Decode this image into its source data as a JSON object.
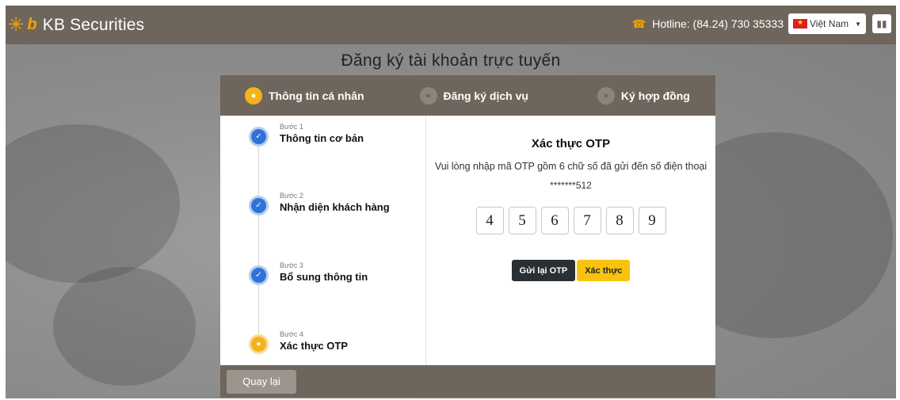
{
  "header": {
    "logo_text": "KB Securities",
    "hotline": "Hotline: (84.24) 730 35333",
    "language": "Việt Nam"
  },
  "page_title": "Đăng ký tài khoản trực tuyến",
  "tabs": [
    {
      "label": "Thông tin cá nhân",
      "active": true
    },
    {
      "label": "Đăng ký dịch vụ",
      "active": false
    },
    {
      "label": "Ký hợp đồng",
      "active": false
    }
  ],
  "steps": [
    {
      "small": "Bước 1",
      "name": "Thông tin cơ bản",
      "status": "done"
    },
    {
      "small": "Bước 2",
      "name": "Nhận diện khách hàng",
      "status": "done"
    },
    {
      "small": "Bước 3",
      "name": "Bổ sung thông tin",
      "status": "done"
    },
    {
      "small": "Bước 4",
      "name": "Xác thực OTP",
      "status": "current"
    }
  ],
  "otp": {
    "title": "Xác thực OTP",
    "description": "Vui lòng nhập mã OTP gồm 6 chữ số đã gửi đến số điện thoại",
    "phone": "*******512",
    "digits": [
      "4",
      "5",
      "6",
      "7",
      "8",
      "9"
    ],
    "resend_label": "Gửi lại OTP",
    "verify_label": "Xác thực"
  },
  "footer": {
    "back_label": "Quay lại"
  },
  "colors": {
    "brand_bar": "#6e665c",
    "accent": "#f5b21a",
    "step_done": "#2f73d8"
  }
}
